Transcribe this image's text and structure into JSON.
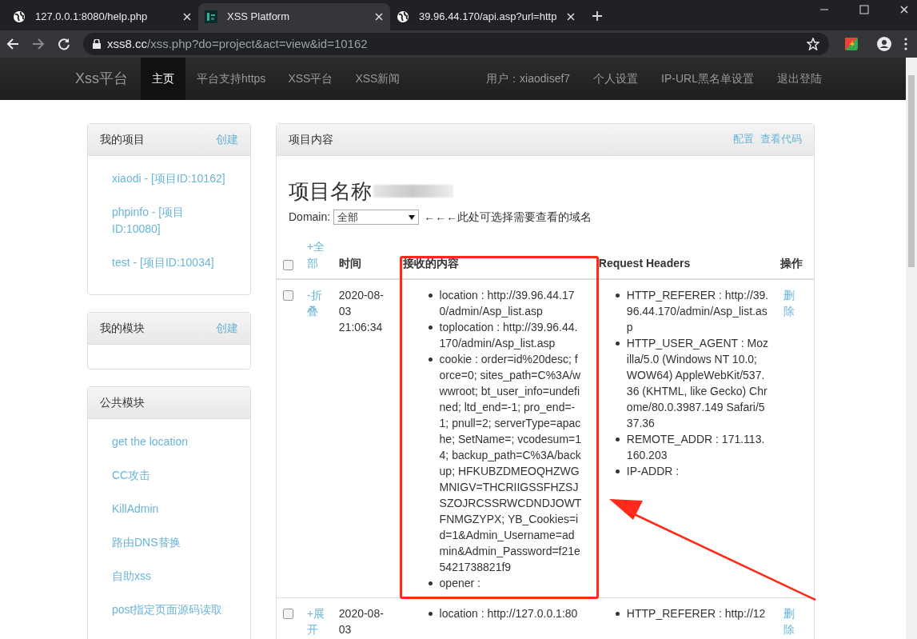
{
  "browser": {
    "tabs": [
      {
        "title": "127.0.0.1:8080/help.php",
        "selected": false
      },
      {
        "title": "XSS Platform",
        "selected": true
      },
      {
        "title": "39.96.44.170/api.asp?url=http",
        "selected": false
      }
    ],
    "address": {
      "host": "xss8.cc",
      "path": "/xss.php?do=project&act=view&id=10162"
    }
  },
  "navbar": {
    "brand": "Xss平台",
    "items": [
      {
        "label": "主页",
        "selected": true
      },
      {
        "label": "平台支持https",
        "selected": false
      },
      {
        "label": "XSS平台",
        "selected": false
      },
      {
        "label": "XSS新闻",
        "selected": false
      }
    ],
    "right_items": [
      "用户：xiaodisef7",
      "个人设置",
      "IP-URL黑名单设置",
      "退出登陆"
    ]
  },
  "sidebar": {
    "panels": [
      {
        "title": "我的项目",
        "action": "创建",
        "items": [
          "xiaodi - [项目ID:10162]",
          "phpinfo - [项目ID:10080]",
          "test - [项目ID:10034]"
        ]
      },
      {
        "title": "我的模块",
        "action": "创建"
      },
      {
        "title": "公共模块",
        "items": [
          "get the location",
          "CC攻击",
          "KillAdmin",
          "路由DNS替换",
          "自助xss",
          "post指定页面源码读取"
        ]
      }
    ]
  },
  "main": {
    "title": "项目内容",
    "actions": [
      "配置",
      "查看代码"
    ],
    "project_heading": "项目名称",
    "domain_label": "Domain:",
    "domain_select": "全部",
    "domain_hint": "←←←此处可选择需要查看的域名",
    "table": {
      "columns": [
        "+全部",
        "时间",
        "接收的内容",
        "Request Headers",
        "操作"
      ],
      "all_checked": false,
      "rows": [
        {
          "checked": false,
          "toggle": "-折叠",
          "time": "2020-08-03 21:06:34",
          "content": [
            "location : http://39.96.44.170/admin/Asp_list.asp",
            "toplocation : http://39.96.44.170/admin/Asp_list.asp",
            "cookie : order=id%20desc; force=0; sites_path=C%3A/wwwroot; bt_user_info=undefined; ltd_end=-1; pro_end=-1; pnull=2; serverType=apache; SetName=; vcodesum=14; backup_path=C%3A/backup; HFKUBZDMEOQHZWGMNIGV=THCRIIGSSFHZSJSZOJRCSSRWCDNDJOWTFNMGZYPX; YB_Cookies=id=1&Admin_Username=admin&Admin_Password=f21e5421738821f9",
            "opener :"
          ],
          "headers": [
            "HTTP_REFERER : http://39.96.44.170/admin/Asp_list.asp",
            "HTTP_USER_AGENT : Mozilla/5.0 (Windows NT 10.0; WOW64) AppleWebKit/537.36 (KHTML, like Gecko) Chrome/80.0.3987.149 Safari/537.36",
            "REMOTE_ADDR : 171.113.160.203",
            "IP-ADDR :"
          ],
          "action": "删除"
        },
        {
          "checked": false,
          "toggle": "+展开",
          "time": "2020-08-03",
          "content": [
            "location : http://127.0.0.1:80"
          ],
          "headers": [
            "HTTP_REFERER : http://12"
          ],
          "action": "删除"
        }
      ]
    }
  }
}
